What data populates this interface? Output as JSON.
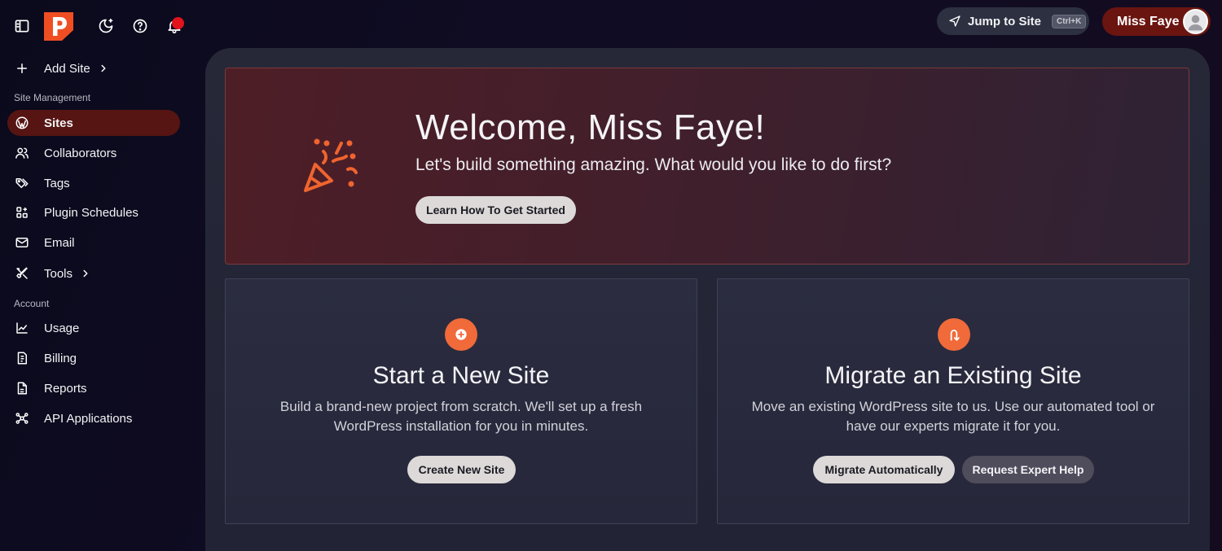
{
  "topbar": {
    "jump_label": "Jump to Site",
    "jump_shortcut": "Ctrl+K",
    "user_name": "Miss Faye",
    "brand_color": "#ef4e23",
    "notification_dot_color": "#e1131b"
  },
  "sidebar": {
    "add_site": "Add Site",
    "section_site_management": "Site Management",
    "section_account": "Account",
    "items": [
      {
        "label": "Sites",
        "icon": "wordpress-icon",
        "active": true
      },
      {
        "label": "Collaborators",
        "icon": "users-icon"
      },
      {
        "label": "Tags",
        "icon": "tags-icon"
      },
      {
        "label": "Plugin Schedules",
        "icon": "grid-icon"
      },
      {
        "label": "Email",
        "icon": "mail-icon"
      },
      {
        "label": "Tools",
        "icon": "tools-icon"
      },
      {
        "label": "Usage",
        "icon": "chart-line-icon"
      },
      {
        "label": "Billing",
        "icon": "invoice-icon"
      },
      {
        "label": "Reports",
        "icon": "file-report-icon"
      },
      {
        "label": "API Applications",
        "icon": "network-icon"
      }
    ]
  },
  "welcome": {
    "title": "Welcome, Miss Faye!",
    "subtitle": "Let's build something amazing. What would you like to do first?",
    "button": "Learn How To Get Started"
  },
  "cards": {
    "new_site": {
      "title": "Start a New Site",
      "description": "Build a brand-new project from scratch. We'll set up a fresh WordPress installation for you in minutes.",
      "button": "Create New Site"
    },
    "migrate": {
      "title": "Migrate an Existing Site",
      "description": "Move an existing WordPress site to us. Use our automated tool or have our experts migrate it for you.",
      "button_primary": "Migrate Automatically",
      "button_secondary": "Request Expert Help"
    }
  }
}
